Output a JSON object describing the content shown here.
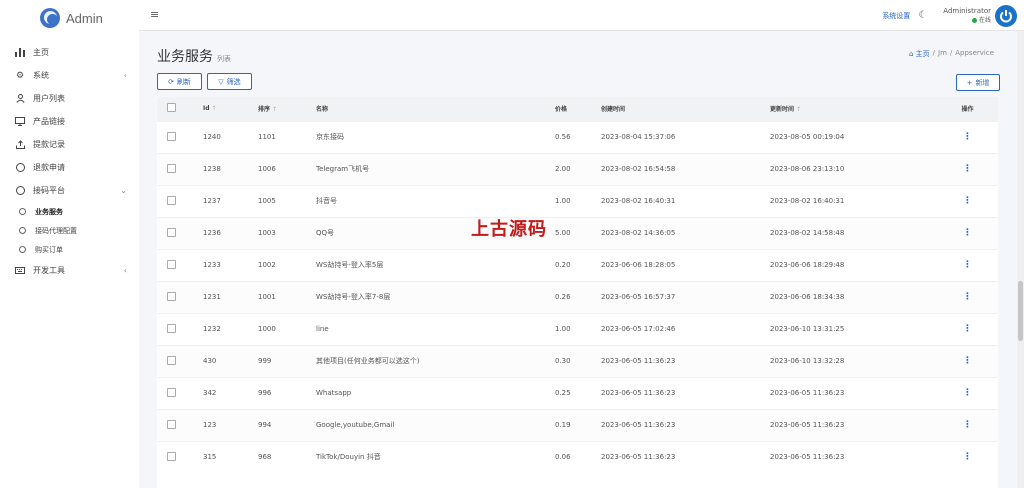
{
  "brand": {
    "name": "Admin"
  },
  "sidebar": {
    "items": [
      {
        "label": "主页",
        "icon": "bar-chart-icon"
      },
      {
        "label": "系统",
        "icon": "gear-icon",
        "caret": "‹"
      },
      {
        "label": "用户列表",
        "icon": "user-icon"
      },
      {
        "label": "产品链接",
        "icon": "monitor-icon"
      },
      {
        "label": "提款记录",
        "icon": "upload-icon"
      },
      {
        "label": "退款申请",
        "icon": "circle-icon"
      },
      {
        "label": "接码平台",
        "icon": "circle-icon",
        "caret": "⌄"
      }
    ],
    "subitems": [
      {
        "label": "业务服务",
        "active": true
      },
      {
        "label": "接码代理配置"
      },
      {
        "label": "购买订单"
      }
    ],
    "dev": {
      "label": "开发工具",
      "icon": "keyboard-icon",
      "caret": "‹"
    }
  },
  "topbar": {
    "menu_icon": "≡",
    "settings_link": "系统设置",
    "theme_icon": "☾",
    "user_name": "Administrator",
    "user_status": "在线"
  },
  "page": {
    "title": "业务服务",
    "subtitle": "列表",
    "breadcrumb": {
      "home": "主页",
      "sep1": "/",
      "mid": "Jm",
      "sep2": "/",
      "current": "Appservice"
    }
  },
  "toolbar": {
    "refresh_label": "刷新",
    "filter_label": "筛选",
    "add_label": "新增"
  },
  "table": {
    "headers": {
      "id": "Id",
      "sort": "排序",
      "name": "名称",
      "price": "价格",
      "created": "创建时间",
      "updated": "更新时间",
      "ops": "操作"
    },
    "rows": [
      {
        "id": "1240",
        "sort": "1101",
        "name": "京东接码",
        "price": "0.56",
        "created": "2023-08-04 15:37:06",
        "updated": "2023-08-05 00:19:04"
      },
      {
        "id": "1238",
        "sort": "1006",
        "name": "Telegram飞机号",
        "price": "2.00",
        "created": "2023-08-02 16:54:58",
        "updated": "2023-08-06 23:13:10"
      },
      {
        "id": "1237",
        "sort": "1005",
        "name": "抖音号",
        "price": "1.00",
        "created": "2023-08-02 16:40:31",
        "updated": "2023-08-02 16:40:31"
      },
      {
        "id": "1236",
        "sort": "1003",
        "name": "QQ号",
        "price": "5.00",
        "created": "2023-08-02 14:36:05",
        "updated": "2023-08-02 14:58:48"
      },
      {
        "id": "1233",
        "sort": "1002",
        "name": "WS劫持号-登入率5层",
        "price": "0.20",
        "created": "2023-06-06 18:28:05",
        "updated": "2023-06-06 18:29:48"
      },
      {
        "id": "1231",
        "sort": "1001",
        "name": "WS劫持号-登入率7-8层",
        "price": "0.26",
        "created": "2023-06-05 16:57:37",
        "updated": "2023-06-06 18:34:38"
      },
      {
        "id": "1232",
        "sort": "1000",
        "name": "line",
        "price": "1.00",
        "created": "2023-06-05 17:02:46",
        "updated": "2023-06-10 13:31:25"
      },
      {
        "id": "430",
        "sort": "999",
        "name": "其他项目(任何业务都可以选这个)",
        "price": "0.30",
        "created": "2023-06-05 11:36:23",
        "updated": "2023-06-10 13:32:28"
      },
      {
        "id": "342",
        "sort": "996",
        "name": "Whatsapp",
        "price": "0.25",
        "created": "2023-06-05 11:36:23",
        "updated": "2023-06-05 11:36:23"
      },
      {
        "id": "123",
        "sort": "994",
        "name": "Google,youtube,Gmail",
        "price": "0.19",
        "created": "2023-06-05 11:36:23",
        "updated": "2023-06-05 11:36:23"
      },
      {
        "id": "315",
        "sort": "968",
        "name": "TikTok/Douyin 抖音",
        "price": "0.06",
        "created": "2023-06-05 11:36:23",
        "updated": "2023-06-05 11:36:23"
      }
    ]
  },
  "watermark": "上古源码",
  "colors": {
    "accent": "#2866c6",
    "online": "#28a745",
    "watermark": "#c31a1a"
  }
}
